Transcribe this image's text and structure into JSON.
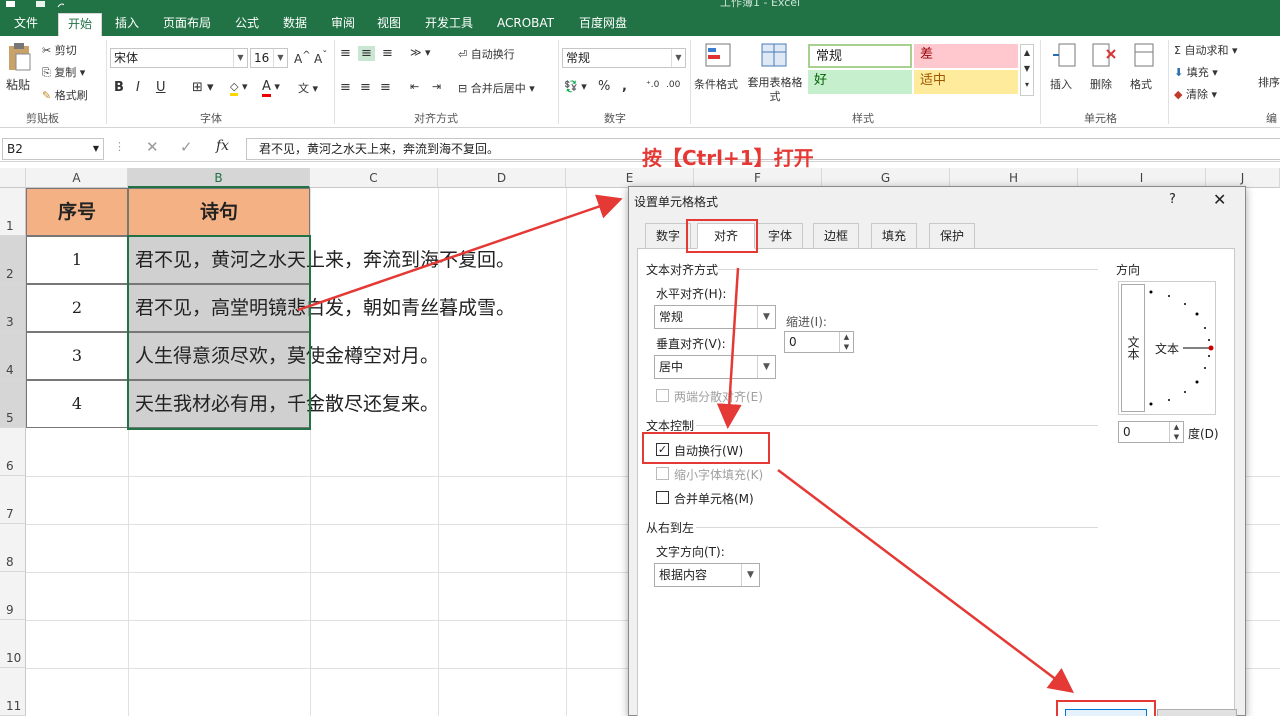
{
  "window_title": "工作簿1 - Excel",
  "ribbon_tabs": [
    "文件",
    "开始",
    "插入",
    "页面布局",
    "公式",
    "数据",
    "审阅",
    "视图",
    "开发工具",
    "ACROBAT",
    "百度网盘"
  ],
  "clipboard": {
    "paste": "粘贴",
    "cut": "剪切",
    "copy": "复制",
    "format_painter": "格式刷",
    "label": "剪贴板"
  },
  "font": {
    "name": "宋体",
    "size": "16",
    "label": "字体",
    "bold": "B",
    "italic": "I",
    "underline": "U",
    "font_color_glyph": "A"
  },
  "alignment": {
    "wrap_text": "自动换行",
    "merge_center": "合并后居中",
    "label": "对齐方式"
  },
  "number": {
    "format": "常规",
    "percent": "%",
    "comma": ",",
    "label": "数字"
  },
  "styles": {
    "cond_format": "条件格式",
    "table_format": "套用表格格式",
    "normal": "常规",
    "bad": "差",
    "good": "好",
    "neutral": "适中",
    "label": "样式"
  },
  "cells_group": {
    "insert": "插入",
    "delete": "删除",
    "format": "格式",
    "label": "单元格"
  },
  "editing": {
    "autosum": "自动求和",
    "fill": "填充",
    "clear": "清除",
    "sort": "排序",
    "label": "编"
  },
  "formula_bar": {
    "name_box": "B2",
    "fx": "fx",
    "content": "君不见，黄河之水天上来，奔流到海不复回。"
  },
  "columns": [
    "A",
    "B",
    "C",
    "D",
    "E",
    "F",
    "G",
    "H",
    "I",
    "J"
  ],
  "rows": [
    "1",
    "2",
    "3",
    "4",
    "5",
    "6",
    "7",
    "8",
    "9",
    "10",
    "11"
  ],
  "table": {
    "header": [
      "序号",
      "诗句"
    ],
    "rows": [
      [
        "1",
        "君不见，黄河之水天上来，奔流到海不复回。"
      ],
      [
        "2",
        "君不见，高堂明镜悲白发，朝如青丝暮成雪。"
      ],
      [
        "3",
        "人生得意须尽欢，莫使金樽空对月。"
      ],
      [
        "4",
        "天生我材必有用，千金散尽还复来。"
      ]
    ]
  },
  "annotation": "按【Ctrl+1】打开",
  "dialog": {
    "title": "设置单元格格式",
    "help": "?",
    "close": "✕",
    "tabs": [
      "数字",
      "对齐",
      "字体",
      "边框",
      "填充",
      "保护"
    ],
    "text_align_section": "文本对齐方式",
    "horizontal_label": "水平对齐(H):",
    "horizontal_value": "常规",
    "indent_label": "缩进(I):",
    "indent_value": "0",
    "vertical_label": "垂直对齐(V):",
    "vertical_value": "居中",
    "justify_distributed": "两端分散对齐(E)",
    "text_control_section": "文本控制",
    "wrap_text": "自动换行(W)",
    "shrink_to_fit": "缩小字体填充(K)",
    "merge_cells": "合并单元格(M)",
    "rtl_section": "从右到左",
    "text_direction_label": "文字方向(T):",
    "text_direction_value": "根据内容",
    "orientation_section": "方向",
    "orientation_vertical_text": "文本",
    "orientation_horizontal_text": "文本",
    "degrees_value": "0",
    "degrees_label": "度(D)"
  }
}
